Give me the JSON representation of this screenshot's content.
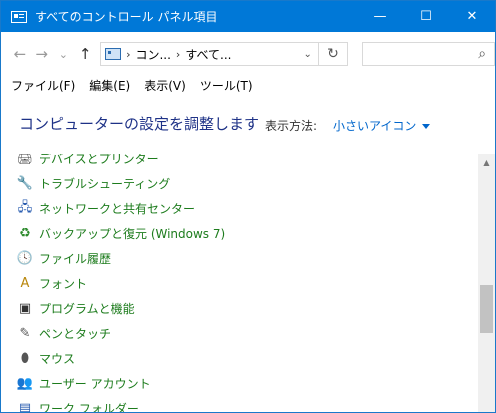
{
  "window": {
    "title": "すべてのコントロール パネル項目"
  },
  "titlebar_buttons": {
    "minimize": "—",
    "maximize": "☐",
    "close": "✕"
  },
  "nav": {
    "back": "←",
    "forward": "→",
    "recent": "⌄",
    "up": "↑"
  },
  "address": {
    "breadcrumbs": [
      "コン...",
      "すべて..."
    ],
    "separator": "›",
    "dropdown": "⌄",
    "refresh": "↻"
  },
  "search": {
    "placeholder": "",
    "icon": "⌕"
  },
  "menubar": {
    "items": [
      "ファイル(F)",
      "編集(E)",
      "表示(V)",
      "ツール(T)"
    ]
  },
  "header": {
    "title": "コンピューターの設定を調整します",
    "viewby_label": "表示方法:",
    "viewby_value": "小さいアイコン"
  },
  "items": [
    {
      "label": "デバイスとプリンター",
      "icon": "printer-icon",
      "glyph": "🖨"
    },
    {
      "label": "トラブルシューティング",
      "icon": "troubleshoot-icon",
      "glyph": "🔧"
    },
    {
      "label": "ネットワークと共有センター",
      "icon": "network-icon",
      "glyph": "🖧"
    },
    {
      "label": "バックアップと復元 (Windows 7)",
      "icon": "backup-icon",
      "glyph": "♻"
    },
    {
      "label": "ファイル履歴",
      "icon": "file-history-icon",
      "glyph": "🕓"
    },
    {
      "label": "フォント",
      "icon": "font-icon",
      "glyph": "A"
    },
    {
      "label": "プログラムと機能",
      "icon": "programs-icon",
      "glyph": "▣"
    },
    {
      "label": "ペンとタッチ",
      "icon": "pen-icon",
      "glyph": "✎"
    },
    {
      "label": "マウス",
      "icon": "mouse-icon",
      "glyph": "⬮"
    },
    {
      "label": "ユーザー アカウント",
      "icon": "user-accounts-icon",
      "glyph": "👥"
    },
    {
      "label": "ワーク フォルダー",
      "icon": "work-folders-icon",
      "glyph": "▤"
    }
  ],
  "colors": {
    "titlebar": "#0078d7",
    "heading": "#1e3287",
    "link": "#0066cc",
    "item_label": "#1d7c1d"
  }
}
